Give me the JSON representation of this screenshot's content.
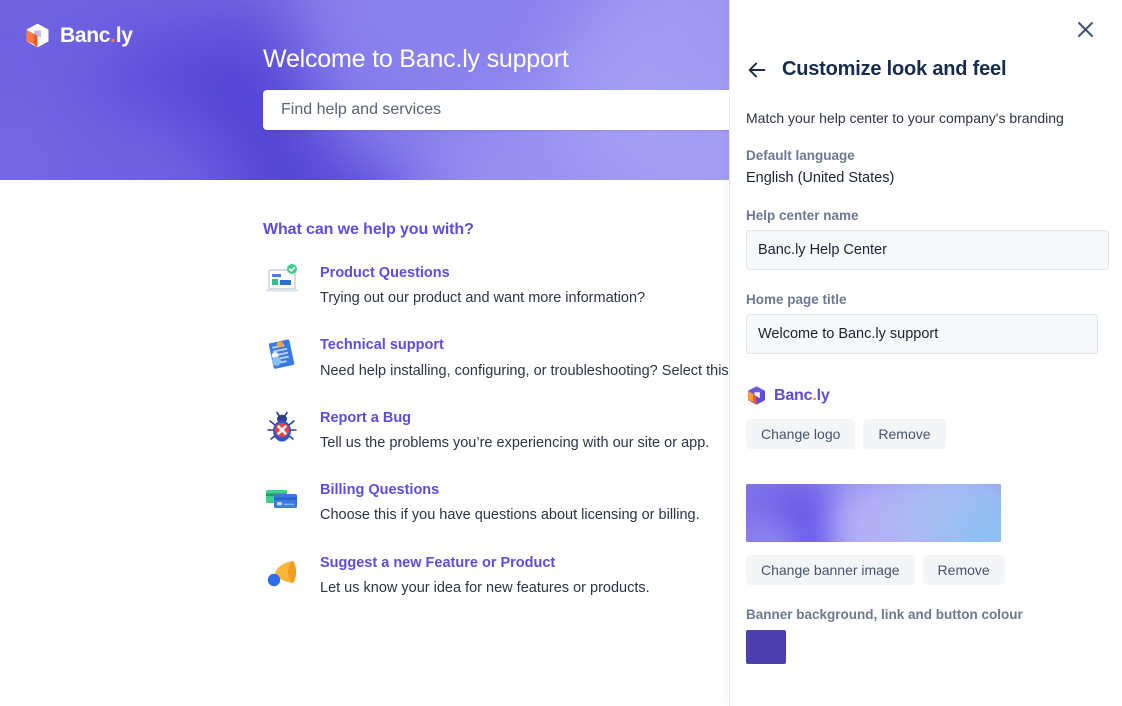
{
  "brand": {
    "logo_text": "Banc",
    "logo_dot": ".",
    "logo_suffix": "ly",
    "accent_color": "#ff7a45",
    "primary_color": "#5d4ddb",
    "swatch_color": "#4d3fae"
  },
  "preview": {
    "banner_title": "Welcome to Banc.ly support",
    "search_placeholder": "Find help and services",
    "section_heading": "What can we help you with?",
    "help_items": [
      {
        "icon": "laptop-check-icon",
        "title": "Product Questions",
        "desc": "Trying out our product and want more information?"
      },
      {
        "icon": "technical-support-icon",
        "title": "Technical support",
        "desc": "Need help installing, configuring, or troubleshooting? Select this to"
      },
      {
        "icon": "bug-icon",
        "title": "Report a Bug",
        "desc": "Tell us the problems you’re experiencing with our site or app."
      },
      {
        "icon": "credit-cards-icon",
        "title": "Billing Questions",
        "desc": "Choose this if you have questions about licensing or billing."
      },
      {
        "icon": "megaphone-icon",
        "title": "Suggest a new Feature or Product",
        "desc": "Let us know your idea for new features or products."
      }
    ]
  },
  "panel": {
    "close_icon": "close-icon",
    "back_icon": "arrow-left-icon",
    "title": "Customize look and feel",
    "subtitle": "Match your help center to your company's branding",
    "default_language_label": "Default language",
    "default_language_value": "English (United States)",
    "help_center_name_label": "Help center name",
    "help_center_name_value": "Banc.ly Help Center",
    "home_page_title_label": "Home page title",
    "home_page_title_value": "Welcome to Banc.ly support",
    "logo_change_label": "Change logo",
    "logo_remove_label": "Remove",
    "banner_change_label": "Change banner image",
    "banner_remove_label": "Remove",
    "colour_label": "Banner background, link and button colour"
  }
}
